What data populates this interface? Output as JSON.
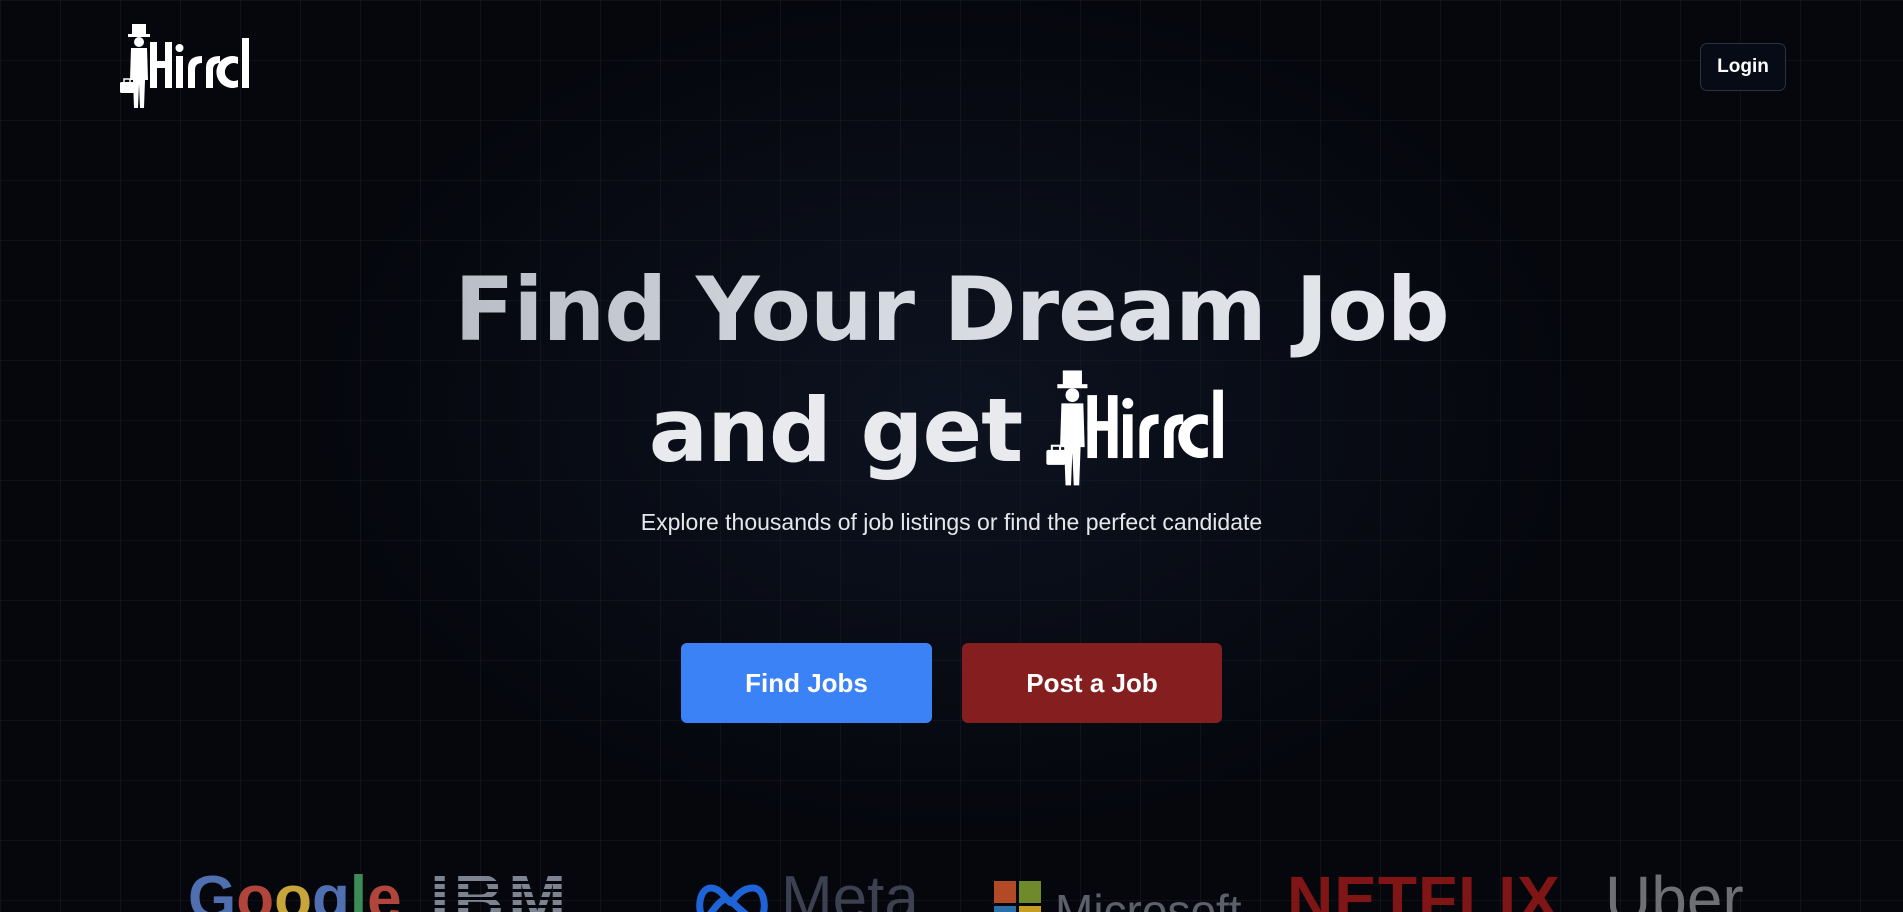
{
  "header": {
    "logo_text": "Hirrd",
    "login_label": "Login"
  },
  "hero": {
    "headline_line1": "Find Your Dream Job",
    "headline_line2_prefix": "and get",
    "inline_logo_text": "Hirrd",
    "subtitle": "Explore thousands of job listings or find the perfect candidate"
  },
  "cta": {
    "find_jobs_label": "Find Jobs",
    "post_job_label": "Post a Job"
  },
  "companies": {
    "google": "Google",
    "ibm": "IBM",
    "meta": "Meta",
    "microsoft": "Microsoft",
    "netflix": "NETFLIX",
    "uber": "Uber"
  },
  "colors": {
    "background": "#05070d",
    "primary_button": "#3b82f6",
    "secondary_button": "#851f1f",
    "login_border": "#2a3342"
  }
}
